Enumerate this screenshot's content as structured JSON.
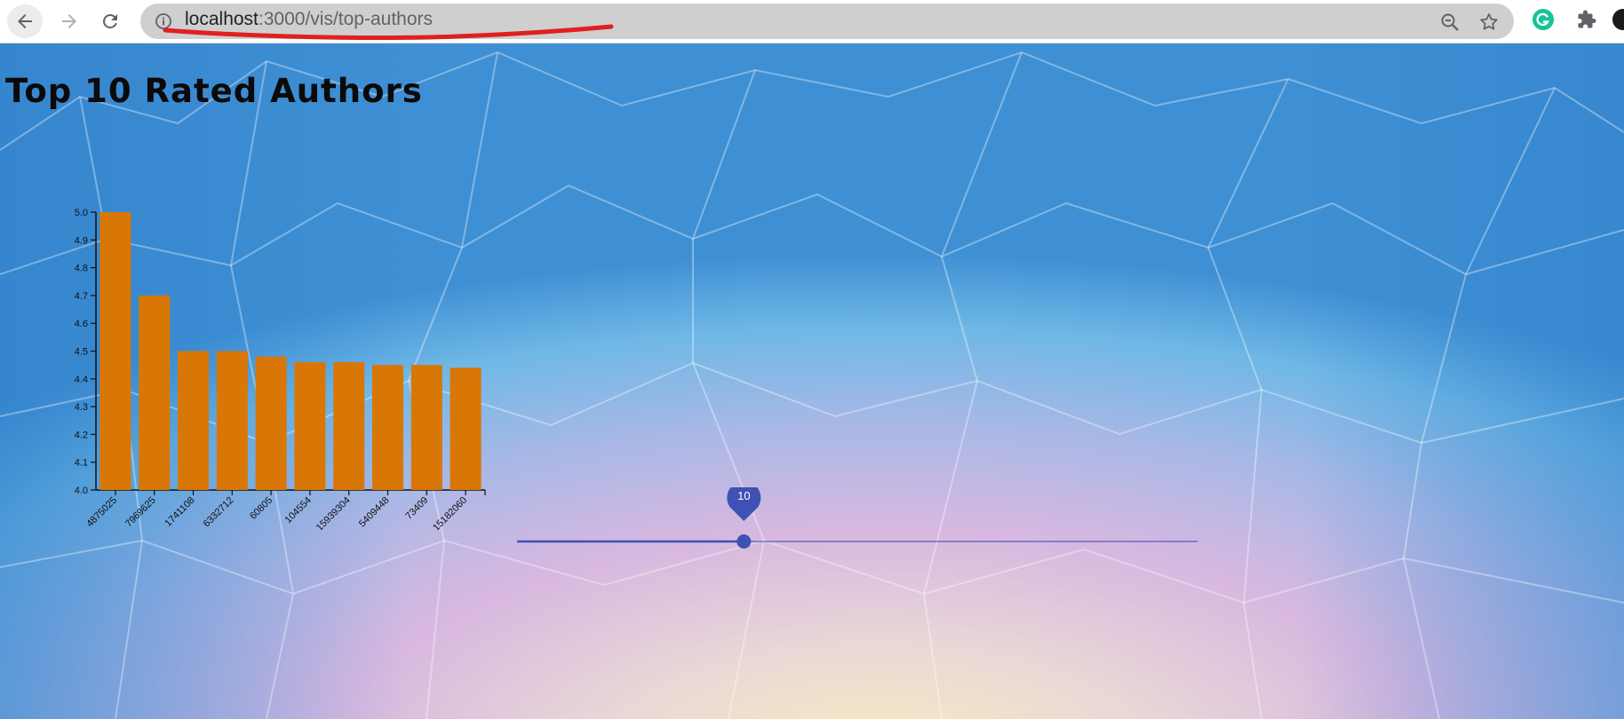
{
  "browser": {
    "url_host": "localhost",
    "url_path": ":3000/vis/top-authors",
    "icons": [
      "back-icon",
      "forward-icon",
      "reload-icon",
      "info-icon",
      "zoom-icon",
      "bookmark-star-icon",
      "grammarly-icon",
      "extensions-puzzle-icon",
      "profile-avatar-icon"
    ]
  },
  "page": {
    "title": "Top 10 Rated Authors"
  },
  "chart_data": {
    "type": "bar",
    "categories": [
      "4875025",
      "7969625",
      "1741108",
      "6332712",
      "60805",
      "104554",
      "15939304",
      "5409448",
      "73409",
      "15182060"
    ],
    "values": [
      5.0,
      4.7,
      4.5,
      4.5,
      4.48,
      4.46,
      4.46,
      4.45,
      4.45,
      4.44
    ],
    "ylim": [
      4.0,
      5.0
    ],
    "yticks": [
      "4.0",
      "4.1",
      "4.2",
      "4.3",
      "4.4",
      "4.5",
      "4.6",
      "4.7",
      "4.8",
      "4.9",
      "5.0"
    ],
    "bar_color": "#d97706"
  },
  "slider": {
    "value": "10",
    "min": 0,
    "max": 30,
    "color": "#3f51b5"
  },
  "colors": {
    "scribble": "#e02020"
  }
}
